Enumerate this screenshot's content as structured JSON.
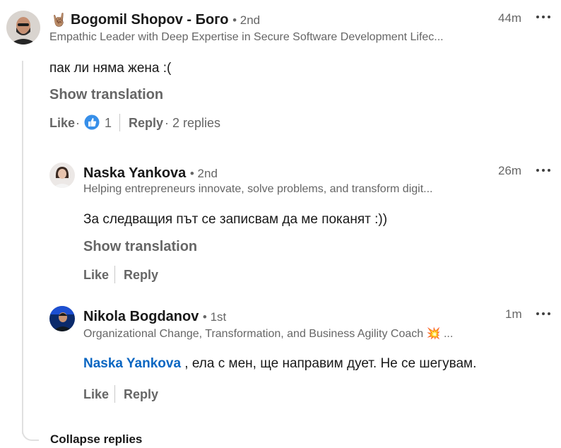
{
  "comment": {
    "author_emoji": "🤘🏽",
    "author": "Bogomil Shopov - Бого",
    "degree": "• 2nd",
    "headline": "Empathic Leader with Deep Expertise in Secure Software Development Lifec...",
    "time": "44m",
    "text": "пак ли няма жена :(",
    "show_translation": "Show translation",
    "like_label": "Like",
    "dot": "·",
    "reaction_count": "1",
    "reply_label": "Reply",
    "replies_count": "· 2 replies"
  },
  "replies": [
    {
      "author": "Naska Yankova",
      "degree": "• 2nd",
      "headline": "Helping entrepreneurs innovate, solve problems, and transform digit...",
      "time": "26m",
      "text": "За следващия път се записвам да ме поканят :))",
      "show_translation": "Show translation",
      "like_label": "Like",
      "reply_label": "Reply"
    },
    {
      "author": "Nikola Bogdanov",
      "degree": "• 1st",
      "headline": "Organizational Change, Transformation, and Business Agility Coach 💥 ...",
      "time": "1m",
      "mention": "Naska Yankova",
      "text": " , ела с мен, ще направим дует. Не се шегувам.",
      "like_label": "Like",
      "reply_label": "Reply"
    }
  ],
  "collapse_label": "Collapse replies",
  "icons": {
    "more": "more-horizontal-icon",
    "like_reaction": "thumbs-up-reaction-icon"
  },
  "colors": {
    "link": "#0a66c2",
    "muted": "#666666",
    "text": "#191919",
    "reaction": "#378fe9"
  }
}
